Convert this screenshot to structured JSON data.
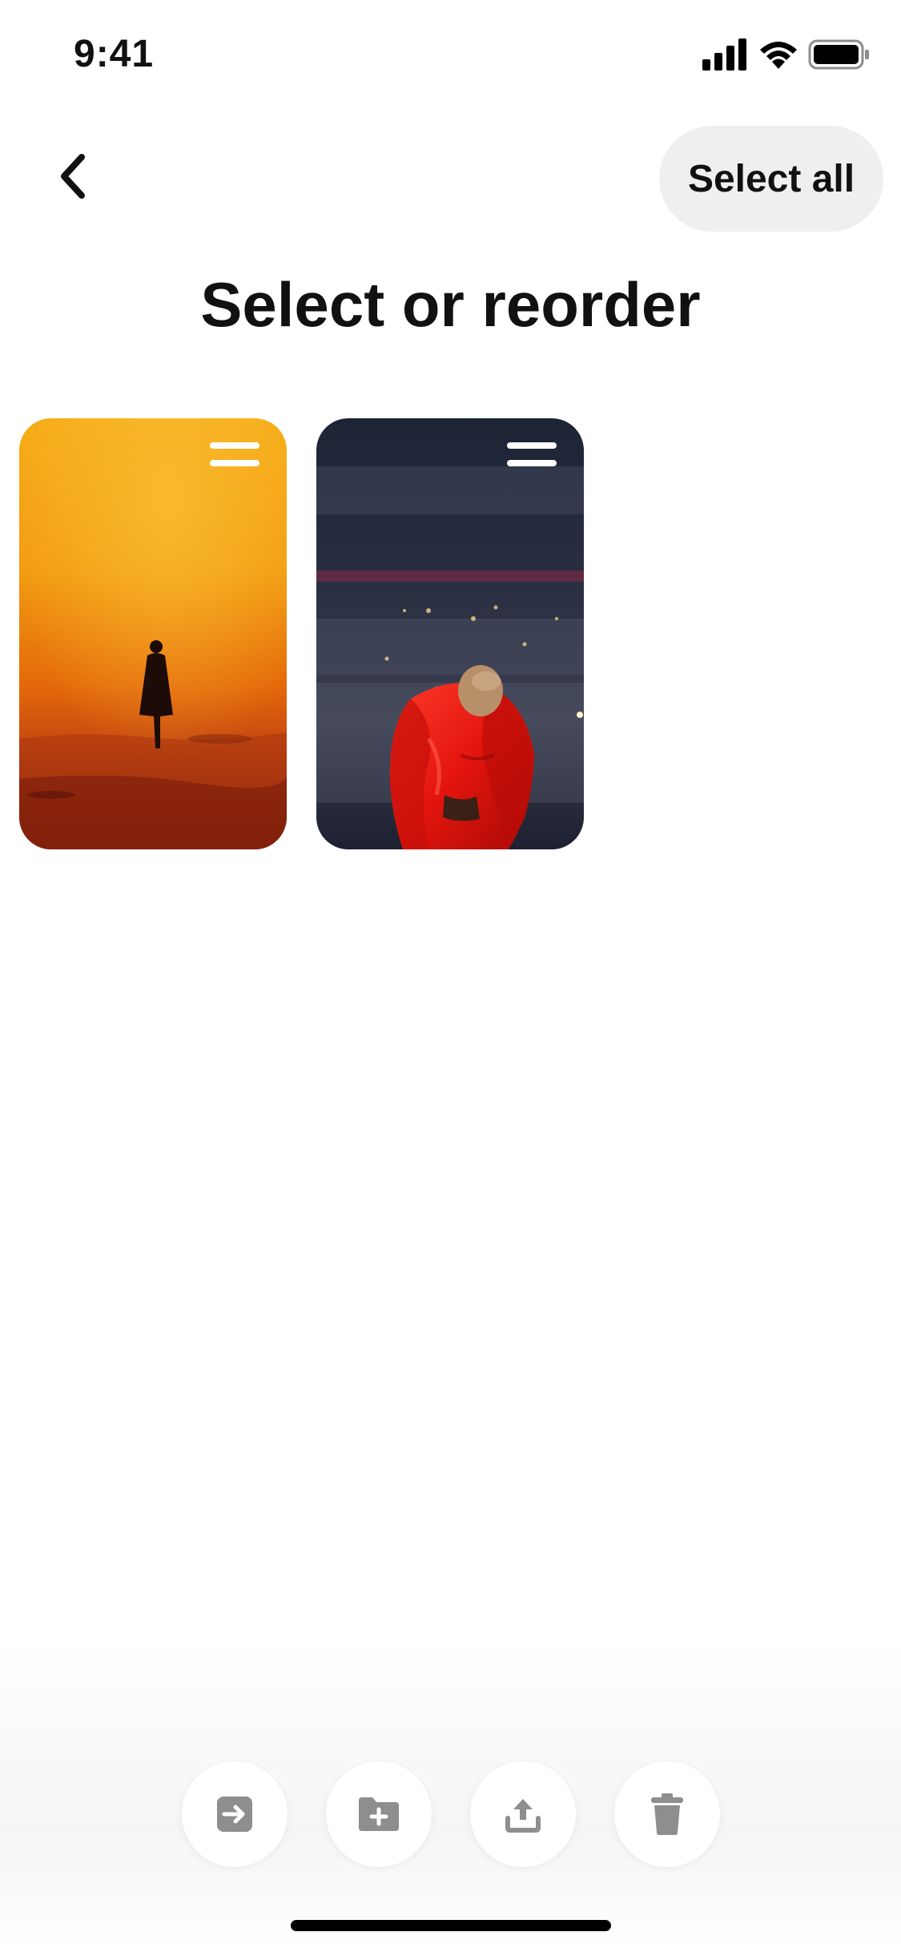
{
  "status_bar": {
    "time": "9:41",
    "icons": [
      "cellular-signal-icon",
      "wifi-icon",
      "battery-icon"
    ]
  },
  "header": {
    "back_icon": "chevron-left-icon",
    "select_all_label": "Select all"
  },
  "title": "Select or reorder",
  "pins": [
    {
      "name": "pin-desert-silhouette",
      "handle_icon": "drag-handle-icon"
    },
    {
      "name": "pin-red-puffer-performer",
      "handle_icon": "drag-handle-icon"
    }
  ],
  "actions": [
    {
      "name": "move-action-button",
      "icon": "move-icon"
    },
    {
      "name": "add-to-section-button",
      "icon": "folder-plus-icon"
    },
    {
      "name": "share-action-button",
      "icon": "share-icon"
    },
    {
      "name": "delete-action-button",
      "icon": "trash-icon"
    }
  ],
  "colors": {
    "pill_bg": "#efefef",
    "icon_disabled": "#8e8e8e",
    "text": "#111111"
  }
}
